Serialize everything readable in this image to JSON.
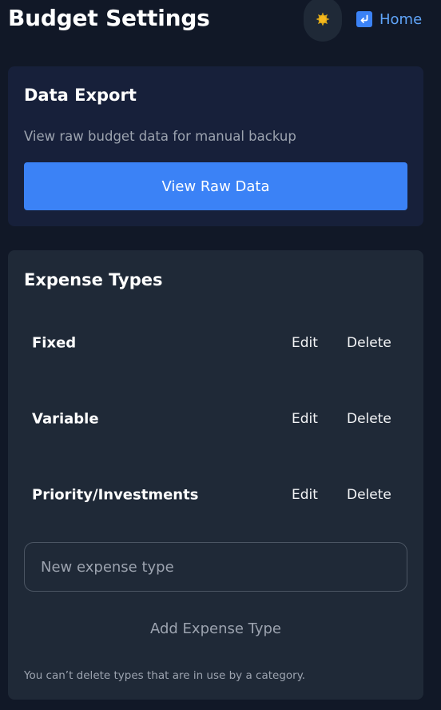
{
  "header": {
    "title": "Budget Settings",
    "theme_toggle_icon": "sun-icon",
    "home_label": "Home",
    "home_icon": "return-arrow-icon"
  },
  "data_export": {
    "title": "Data Export",
    "description": "View raw budget data for manual backup",
    "button_label": "View Raw Data"
  },
  "expense_types": {
    "title": "Expense Types",
    "items": [
      {
        "name": "Fixed",
        "edit_label": "Edit",
        "delete_label": "Delete"
      },
      {
        "name": "Variable",
        "edit_label": "Edit",
        "delete_label": "Delete"
      },
      {
        "name": "Priority/Investments",
        "edit_label": "Edit",
        "delete_label": "Delete"
      }
    ],
    "input_placeholder": "New expense type",
    "add_button_label": "Add Expense Type",
    "footnote": "You can’t delete types that are in use by a category."
  },
  "colors": {
    "background": "#111827",
    "card": "#1f2937",
    "export_card": "#17203a",
    "accent": "#3b82f6",
    "link": "#60a5fa",
    "muted_text": "#9ca3af"
  }
}
